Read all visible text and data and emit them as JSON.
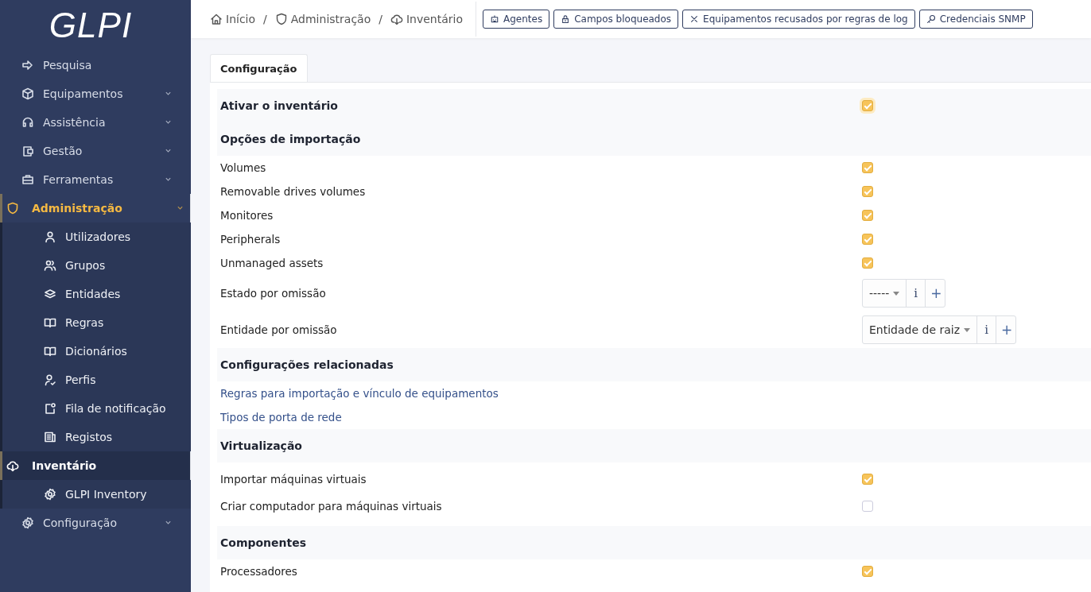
{
  "sidebar": {
    "logo": "GLPI",
    "items": [
      {
        "label": "Pesquisa",
        "expandable": false,
        "selected": false
      },
      {
        "label": "Equipamentos",
        "expandable": true,
        "selected": false
      },
      {
        "label": "Assistência",
        "expandable": true,
        "selected": false
      },
      {
        "label": "Gestão",
        "expandable": true,
        "selected": false
      },
      {
        "label": "Ferramentas",
        "expandable": true,
        "selected": false
      },
      {
        "label": "Administração",
        "expandable": true,
        "selected": true,
        "children": [
          {
            "label": "Utilizadores",
            "selected": false
          },
          {
            "label": "Grupos",
            "selected": false
          },
          {
            "label": "Entidades",
            "selected": false
          },
          {
            "label": "Regras",
            "selected": false
          },
          {
            "label": "Dicionários",
            "selected": false
          },
          {
            "label": "Perfis",
            "selected": false
          },
          {
            "label": "Fila de notificação",
            "selected": false
          },
          {
            "label": "Registos",
            "selected": false
          },
          {
            "label": "Inventário",
            "selected": true
          },
          {
            "label": "GLPI Inventory",
            "selected": false
          }
        ]
      },
      {
        "label": "Configuração",
        "expandable": true,
        "selected": false
      }
    ]
  },
  "breadcrumb": {
    "separator": "/",
    "items": [
      "Início",
      "Administração",
      "Inventário"
    ]
  },
  "toolbar": [
    "Agentes",
    "Campos bloqueados",
    "Equipamentos recusados por regras de log",
    "Credenciais SNMP"
  ],
  "tabs": [
    {
      "label": "Configuração",
      "selected": true
    }
  ],
  "sections": [
    {
      "title": "Ativar o inventário",
      "checked": true
    },
    {
      "title": "Opções de importação",
      "rows": [
        {
          "kind": "checkbox",
          "label": "Volumes",
          "checked": true
        },
        {
          "kind": "checkbox",
          "label": "Removable drives volumes",
          "checked": true
        },
        {
          "kind": "checkbox",
          "label": "Monitores",
          "checked": true
        },
        {
          "kind": "checkbox",
          "label": "Peripherals",
          "checked": true
        },
        {
          "kind": "checkbox",
          "label": "Unmanaged assets",
          "checked": true
        },
        {
          "kind": "select",
          "label": "Estado por omissão",
          "value": "-----",
          "info": "i",
          "add": "+"
        },
        {
          "kind": "select",
          "label": "Entidade por omissão",
          "value": "Entidade de raiz",
          "info": "i",
          "add": "+"
        }
      ]
    },
    {
      "title": "Configurações relacionadas",
      "rows": [
        {
          "kind": "link",
          "label": "Regras para importação e vínculo de equipamentos"
        },
        {
          "kind": "link",
          "label": "Tipos de porta de rede"
        }
      ]
    },
    {
      "title": "Virtualização",
      "rows": [
        {
          "kind": "checkbox",
          "label": "Importar máquinas virtuais",
          "checked": true
        },
        {
          "kind": "checkbox",
          "label": "Criar computador para máquinas virtuais",
          "checked": false
        }
      ]
    },
    {
      "title": "Componentes",
      "rows": [
        {
          "kind": "checkbox",
          "label": "Processadores",
          "checked": true
        }
      ]
    }
  ]
}
